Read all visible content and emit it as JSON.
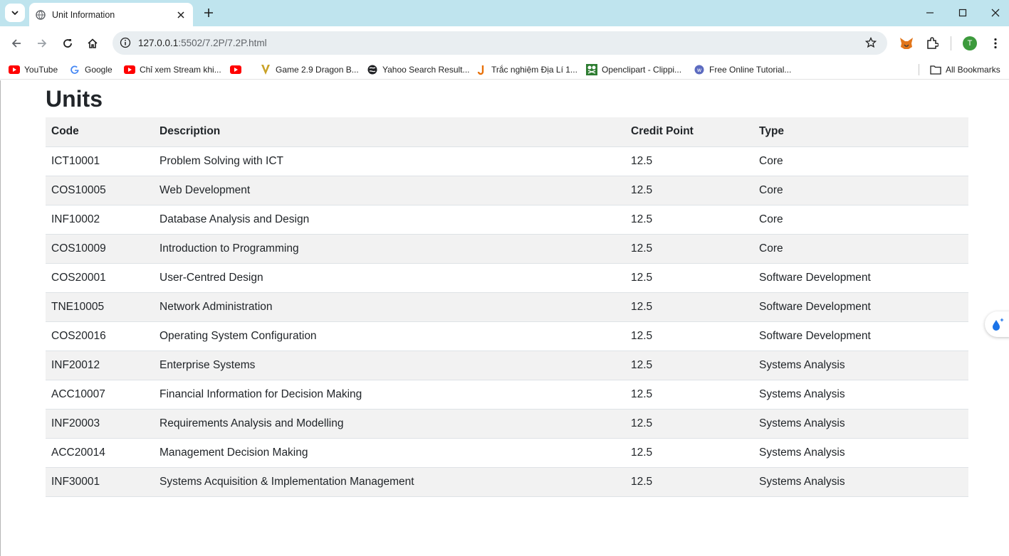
{
  "browser": {
    "tab": {
      "title": "Unit Information"
    },
    "address": {
      "host": "127.0.0.1",
      "path": ":5502/7.2P/7.2P.html"
    },
    "profile_initial": "T",
    "bookmarks": [
      {
        "label": "YouTube",
        "icon": "youtube-icon"
      },
      {
        "label": "Google",
        "icon": "google-icon"
      },
      {
        "label": "Chỉ xem Stream khi...",
        "icon": "youtube-icon"
      },
      {
        "label": "",
        "icon": "youtube-icon"
      },
      {
        "label": "Game 2.9 Dragon B...",
        "icon": "game-icon"
      },
      {
        "label": "Yahoo Search Result...",
        "icon": "globe-icon"
      },
      {
        "label": "Trắc nghiệm Địa Lí 1...",
        "icon": "j-icon"
      },
      {
        "label": "Openclipart - Clippi...",
        "icon": "openclipart-icon"
      },
      {
        "label": "Free Online Tutorial...",
        "icon": "tutorial-icon"
      }
    ],
    "all_bookmarks_label": "All Bookmarks"
  },
  "page": {
    "heading": "Units",
    "table": {
      "headers": [
        "Code",
        "Description",
        "Credit Point",
        "Type"
      ],
      "rows": [
        [
          "ICT10001",
          "Problem Solving with ICT",
          "12.5",
          "Core"
        ],
        [
          "COS10005",
          "Web Development",
          "12.5",
          "Core"
        ],
        [
          "INF10002",
          "Database Analysis and Design",
          "12.5",
          "Core"
        ],
        [
          "COS10009",
          "Introduction to Programming",
          "12.5",
          "Core"
        ],
        [
          "COS20001",
          "User-Centred Design",
          "12.5",
          "Software Development"
        ],
        [
          "TNE10005",
          "Network Administration",
          "12.5",
          "Software Development"
        ],
        [
          "COS20016",
          "Operating System Configuration",
          "12.5",
          "Software Development"
        ],
        [
          "INF20012",
          "Enterprise Systems",
          "12.5",
          "Systems Analysis"
        ],
        [
          "ACC10007",
          "Financial Information for Decision Making",
          "12.5",
          "Systems Analysis"
        ],
        [
          "INF20003",
          "Requirements Analysis and Modelling",
          "12.5",
          "Systems Analysis"
        ],
        [
          "ACC20014",
          "Management Decision Making",
          "12.5",
          "Systems Analysis"
        ],
        [
          "INF30001",
          "Systems Acquisition & Implementation Management",
          "12.5",
          "Systems Analysis"
        ]
      ]
    }
  },
  "colors": {
    "tabstrip": "#bfe4ee",
    "table_stripe": "#f2f2f2",
    "text": "#212529",
    "youtube_red": "#ff0000"
  }
}
